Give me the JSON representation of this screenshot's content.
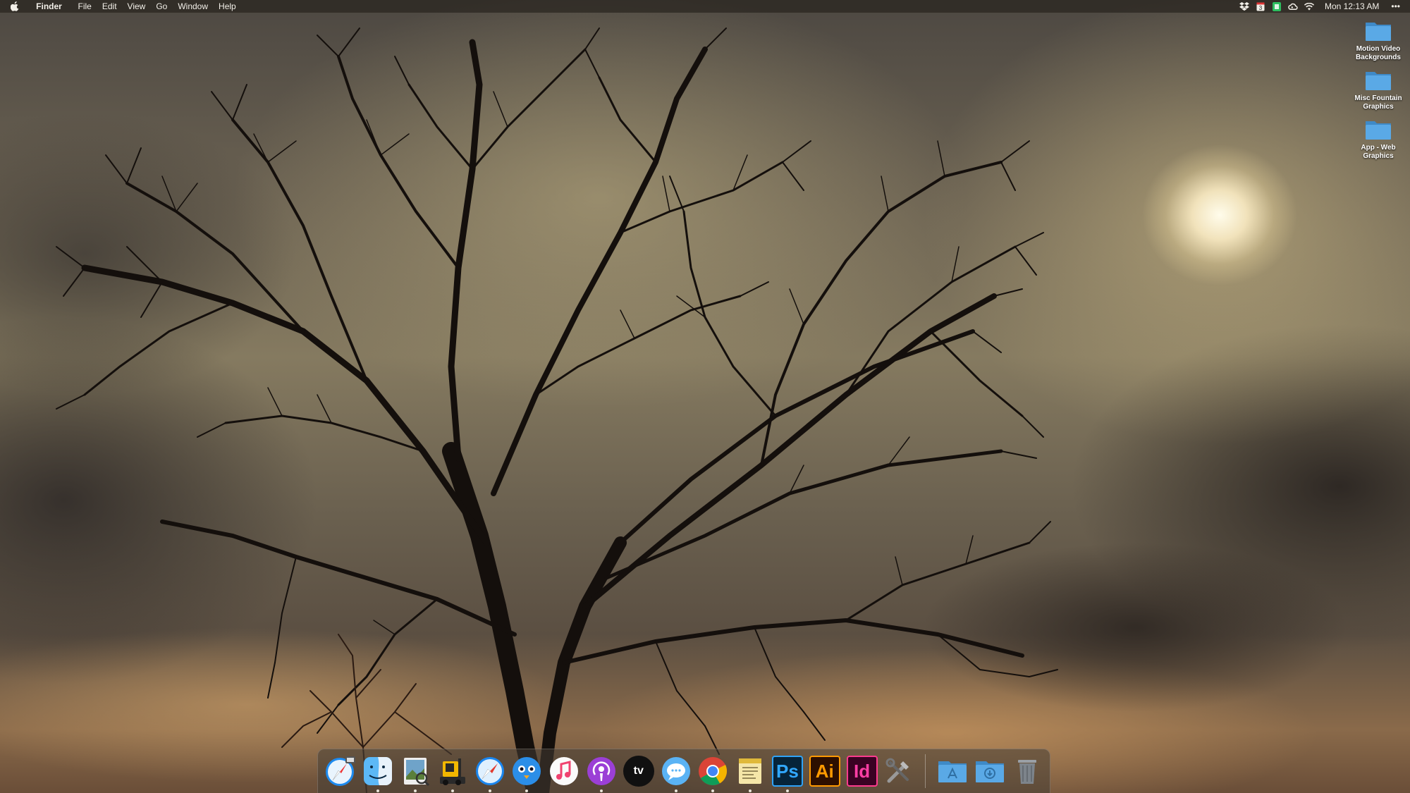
{
  "menubar": {
    "app_name": "Finder",
    "menus": [
      "File",
      "Edit",
      "View",
      "Go",
      "Window",
      "Help"
    ],
    "clock": "Mon 12:13 AM",
    "status_icons": [
      "dropbox-icon",
      "calendar-badge-icon",
      "evernote-icon",
      "creative-cloud-icon",
      "wifi-icon"
    ]
  },
  "desktop": {
    "items": [
      {
        "label": "Motion Video Backgrounds",
        "icon": "folder-icon"
      },
      {
        "label": "Misc Fountain Graphics",
        "icon": "folder-icon"
      },
      {
        "label": "App - Web Graphics",
        "icon": "folder-icon"
      }
    ]
  },
  "dock": {
    "apps": [
      {
        "name": "safari-monitor-icon",
        "running": false
      },
      {
        "name": "finder-icon",
        "running": true
      },
      {
        "name": "preview-icon",
        "running": true
      },
      {
        "name": "forklift-icon",
        "running": true
      },
      {
        "name": "safari-icon",
        "running": true
      },
      {
        "name": "tweetbot-icon",
        "running": true
      },
      {
        "name": "music-icon",
        "running": false
      },
      {
        "name": "podcasts-icon",
        "running": true
      },
      {
        "name": "apple-tv-icon",
        "running": false
      },
      {
        "name": "messages-icon",
        "running": true
      },
      {
        "name": "chrome-icon",
        "running": true
      },
      {
        "name": "notes-icon",
        "running": true
      },
      {
        "name": "photoshop-icon",
        "running": true
      },
      {
        "name": "illustrator-icon",
        "running": false
      },
      {
        "name": "indesign-icon",
        "running": false
      },
      {
        "name": "system-tools-icon",
        "running": false
      }
    ],
    "tile_labels": {
      "photoshop": "Ps",
      "illustrator": "Ai",
      "indesign": "Id",
      "tv": "tv"
    },
    "right_items": [
      "applications-folder-icon",
      "downloads-folder-icon",
      "trash-icon"
    ]
  },
  "colors": {
    "folder": "#5aa9e6",
    "menubar_text": "#f2efe8",
    "photoshop": "#31a8ff",
    "illustrator": "#ff9a00",
    "indesign": "#ff3ea5"
  }
}
